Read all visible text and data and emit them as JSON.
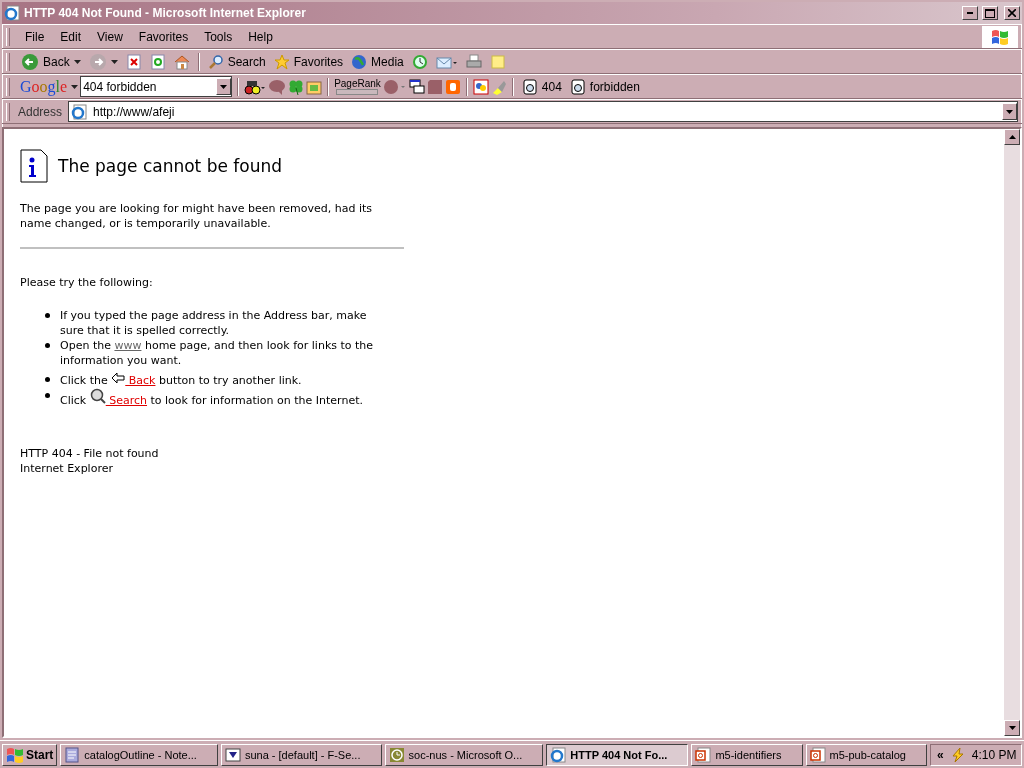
{
  "window": {
    "title": "HTTP 404 Not Found - Microsoft Internet Explorer"
  },
  "menu": [
    "File",
    "Edit",
    "View",
    "Favorites",
    "Tools",
    "Help"
  ],
  "toolbar": [
    {
      "kind": "back",
      "label": "Back"
    },
    {
      "kind": "forward"
    },
    {
      "kind": "stop"
    },
    {
      "kind": "refresh"
    },
    {
      "kind": "home"
    },
    {
      "kind": "separator"
    },
    {
      "kind": "search",
      "label": "Search"
    },
    {
      "kind": "favorites",
      "label": "Favorites"
    },
    {
      "kind": "media",
      "label": "Media"
    },
    {
      "kind": "history"
    },
    {
      "kind": "mail"
    },
    {
      "kind": "print"
    },
    {
      "kind": "note"
    }
  ],
  "google_bar": {
    "logo": "Google",
    "query": "404 forbidden",
    "pagerank_label": "PageRank",
    "highlights": [
      "404",
      "forbidden"
    ]
  },
  "address": {
    "label": "Address",
    "value": "http://www/afeji"
  },
  "page": {
    "heading": "The page cannot be found",
    "intro": "The page you are looking for might have been removed, had its name changed, or is temporarily unavailable.",
    "try_heading": "Please try the following:",
    "bullets": [
      [
        {
          "kind": "text",
          "text": "If you typed the page address in the Address bar, make sure that it is spelled correctly."
        }
      ],
      [
        {
          "kind": "text",
          "text": "Open the "
        },
        {
          "kind": "link",
          "text": "www"
        },
        {
          "kind": "text",
          "text": " home page, and then look for links to the information you want."
        }
      ],
      [
        {
          "kind": "text",
          "text": "Click the "
        },
        {
          "kind": "back-link",
          "text": " Back"
        },
        {
          "kind": "text",
          "text": " button to try another link."
        }
      ],
      [
        {
          "kind": "text",
          "text": "Click "
        },
        {
          "kind": "search-link",
          "text": " Search"
        },
        {
          "kind": "text",
          "text": " to look for information on the Internet."
        }
      ]
    ],
    "footer": [
      "HTTP 404 - File not found",
      "Internet Explorer"
    ]
  },
  "taskbar": {
    "start": "Start",
    "tasks": [
      {
        "kind": "notepad",
        "label": "catalogOutline - Note...",
        "selected": false
      },
      {
        "kind": "terminal",
        "label": "suna - [default] - F-Se...",
        "selected": false
      },
      {
        "kind": "calendar",
        "label": "soc-nus - Microsoft O...",
        "selected": false
      },
      {
        "kind": "browser",
        "label": "HTTP 404 Not Fo...",
        "selected": true
      },
      {
        "kind": "document",
        "label": "m5-identifiers",
        "selected": false
      },
      {
        "kind": "document",
        "label": "m5-pub-catalog",
        "selected": false
      }
    ],
    "tray_toggle": "«",
    "clock": "4:10 PM"
  }
}
